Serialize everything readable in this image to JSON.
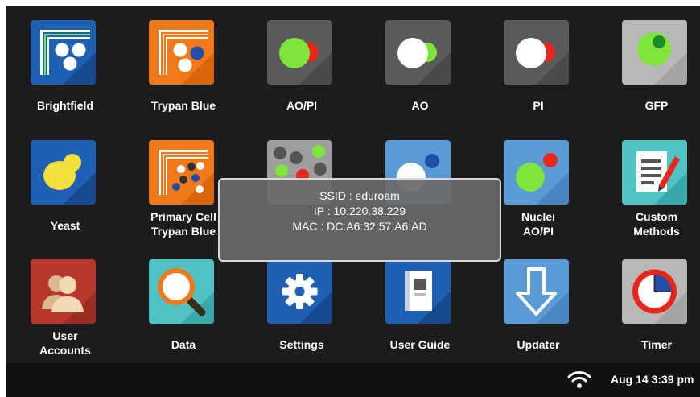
{
  "apps": {
    "brightfield": "Brightfield",
    "trypan_blue": "Trypan Blue",
    "ao_pi": "AO/PI",
    "ao": "AO",
    "pi": "PI",
    "gfp": "GFP",
    "yeast": "Yeast",
    "primary_cell_trypan_blue": [
      "Primary Cell",
      "Trypan Blue"
    ],
    "nuclei_ao_pi": [
      "Nuclei",
      "AO/PI"
    ],
    "custom_methods": [
      "Custom",
      "Methods"
    ],
    "user_accounts": [
      "User",
      "Accounts"
    ],
    "data": "Data",
    "settings": "Settings",
    "user_guide": "User Guide",
    "updater": "Updater",
    "timer": "Timer"
  },
  "network_popup": {
    "ssid": "SSID : eduroam",
    "ip": "IP : 10.220.38.229",
    "mac": "MAC : DC:A6:32:57:A6:AD"
  },
  "status_bar": {
    "wifi_icon": "wifi-icon",
    "datetime": "Aug 14 3:39 pm"
  },
  "colors": {
    "background": "#1c1c1c",
    "blue_tile": "#1f5fb4",
    "orange_tile": "#f07a1a",
    "gray_tile": "#5a5a5a",
    "green_dot": "#7ee53a",
    "red_dot": "#e8261c"
  }
}
